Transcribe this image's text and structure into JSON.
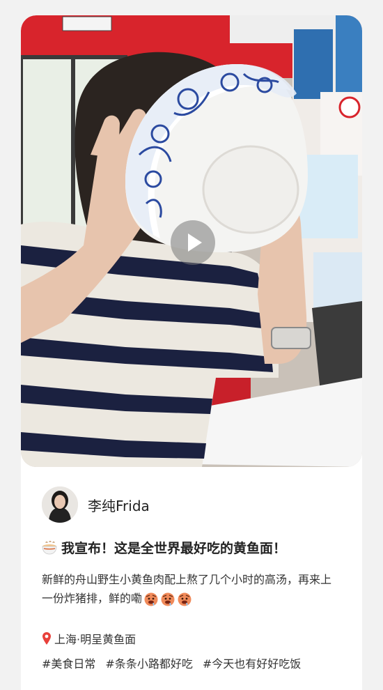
{
  "post": {
    "author": {
      "name": "李纯Frida"
    },
    "title": "我宣布！这是全世界最好吃的黄鱼面！",
    "body": "新鲜的舟山野生小黄鱼肉配上熬了几个小时的高汤，再来上一份炸猪排，鲜的嘞",
    "location": "上海·明呈黄鱼面",
    "hashtags": [
      "#美食日常",
      "#条条小路都好吃",
      "#今天也有好好吃饭"
    ],
    "media": {
      "type": "video",
      "icon": "play-icon"
    }
  },
  "colors": {
    "background": "#f2f2f2",
    "card": "#ffffff",
    "text": "#222222",
    "stripe_dark": "#1b2140",
    "stripe_light": "#ece8e0",
    "wall_red": "#d8242c"
  }
}
